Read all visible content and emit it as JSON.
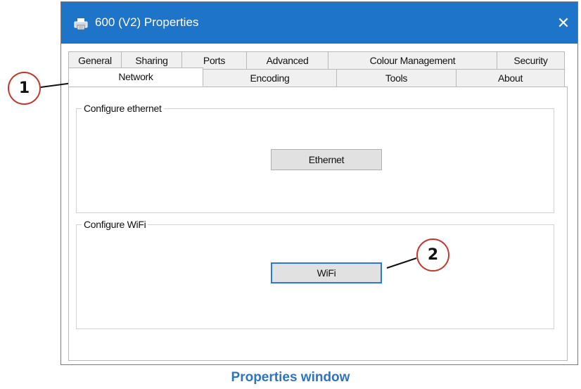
{
  "window": {
    "title": "600 (V2) Properties",
    "close_glyph": "✕",
    "titlebar_color": "#1e74c9"
  },
  "tabs": {
    "back_row": [
      "General",
      "Sharing",
      "Ports",
      "Advanced",
      "Colour Management",
      "Security"
    ],
    "front_row": [
      "Network",
      "Encoding",
      "Tools",
      "About"
    ],
    "active": "Network"
  },
  "panel": {
    "ethernet_group": {
      "legend": "Configure ethernet",
      "button": "Ethernet"
    },
    "wifi_group": {
      "legend": "Configure WiFi",
      "button": "WiFi"
    }
  },
  "callouts": {
    "one": "1",
    "two": "2",
    "color": "#c0392b"
  },
  "caption": "Properties window",
  "caption_color": "#2f74c0"
}
